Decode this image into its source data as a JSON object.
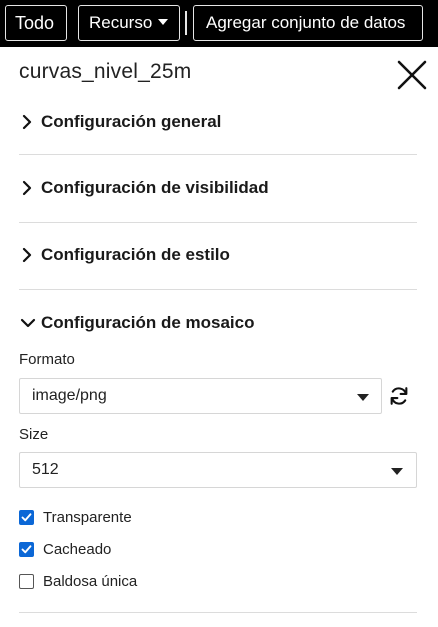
{
  "topbar": {
    "todo_label": "Todo",
    "recurso_label": "Recurso",
    "agregar_label": "Agregar conjunto de datos"
  },
  "panel": {
    "title": "curvas_nivel_25m"
  },
  "sections": {
    "general": "Configuración general",
    "visibilidad": "Configuración de visibilidad",
    "estilo": "Configuración de estilo",
    "mosaico": "Configuración de mosaico"
  },
  "mosaico": {
    "formato_label": "Formato",
    "formato_value": "image/png",
    "size_label": "Size",
    "size_value": "512",
    "checks": [
      {
        "label": "Transparente",
        "checked": true
      },
      {
        "label": "Cacheado",
        "checked": true
      },
      {
        "label": "Baldosa única",
        "checked": false
      }
    ]
  },
  "colors": {
    "topbar_bg": "#000000",
    "checkbox_accent": "#0b67d6"
  },
  "icons": [
    "close-icon",
    "chevron-right-icon",
    "chevron-down-icon",
    "refresh-icon",
    "caret-down-icon"
  ]
}
